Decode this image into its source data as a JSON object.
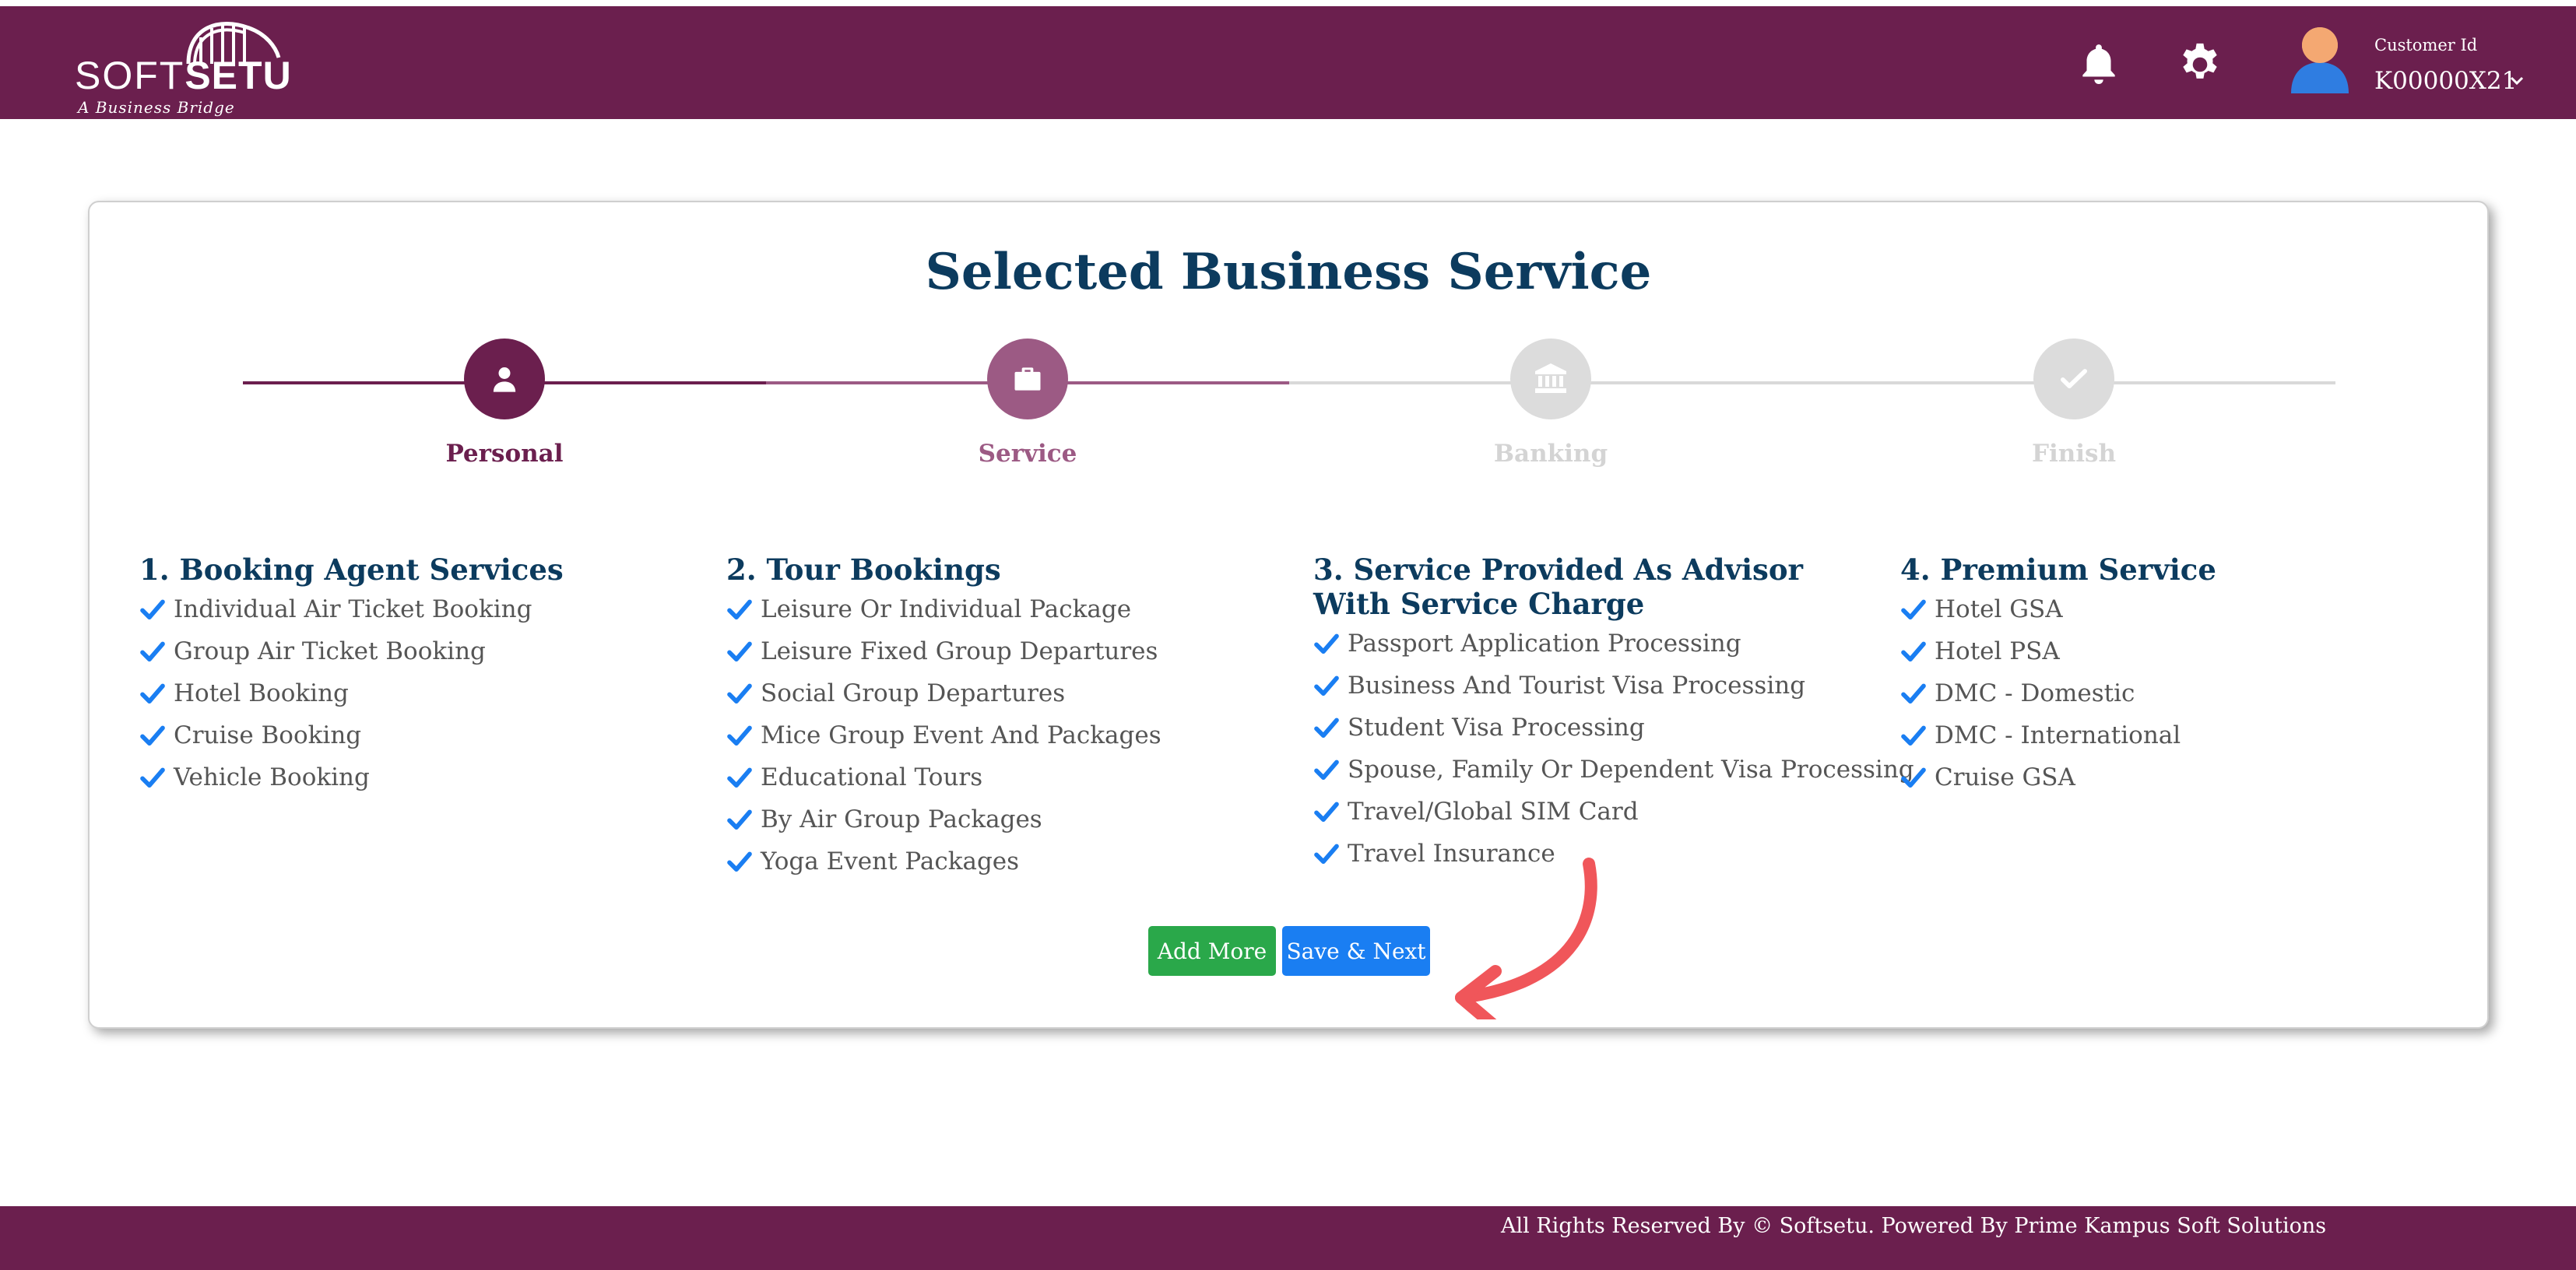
{
  "header": {
    "logo": {
      "soft": "SOFT",
      "setu": "SETU",
      "tagline": "A Business Bridge"
    },
    "customer_label": "Customer Id",
    "customer_id": "K00000X21",
    "icons": [
      "bell-icon",
      "gear-icon",
      "user-avatar-icon",
      "chevron-down-icon"
    ]
  },
  "colors": {
    "brand": "#6b1f4e",
    "title": "#0c3b5e",
    "check": "#1a7ef2",
    "add_button": "#2aa84a",
    "save_button": "#1a7ef2",
    "annotation_arrow": "#f0565a"
  },
  "page": {
    "title": "Selected Business Service"
  },
  "steps": [
    {
      "label": "Personal",
      "state": "completed",
      "icon": "user-icon"
    },
    {
      "label": "Service",
      "state": "active",
      "icon": "briefcase-icon"
    },
    {
      "label": "Banking",
      "state": "pending",
      "icon": "bank-icon"
    },
    {
      "label": "Finish",
      "state": "pending",
      "icon": "check-icon"
    }
  ],
  "services": [
    {
      "title": "1. Booking Agent Services",
      "items": [
        "Individual Air Ticket Booking",
        "Group Air Ticket Booking",
        "Hotel Booking",
        "Cruise Booking",
        "Vehicle Booking"
      ]
    },
    {
      "title": "2. Tour Bookings",
      "items": [
        "Leisure Or Individual Package",
        "Leisure Fixed Group Departures",
        "Social Group Departures",
        "Mice Group Event And Packages",
        "Educational Tours",
        "By Air Group Packages",
        "Yoga Event Packages"
      ]
    },
    {
      "title": "3. Service Provided As Advisor With Service Charge",
      "items": [
        "Passport Application Processing",
        "Business And Tourist Visa Processing",
        "Student Visa Processing",
        "Spouse, Family Or Dependent Visa Processing",
        "Travel/Global SIM Card",
        "Travel Insurance"
      ]
    },
    {
      "title": "4. Premium Service",
      "items": [
        "Hotel GSA",
        "Hotel PSA",
        "DMC - Domestic",
        "DMC - International",
        "Cruise GSA"
      ]
    }
  ],
  "buttons": {
    "add_more": "Add More",
    "save_next": "Save & Next"
  },
  "footer": {
    "text": "All Rights Reserved By © Softsetu. Powered By Prime Kampus Soft Solutions"
  }
}
